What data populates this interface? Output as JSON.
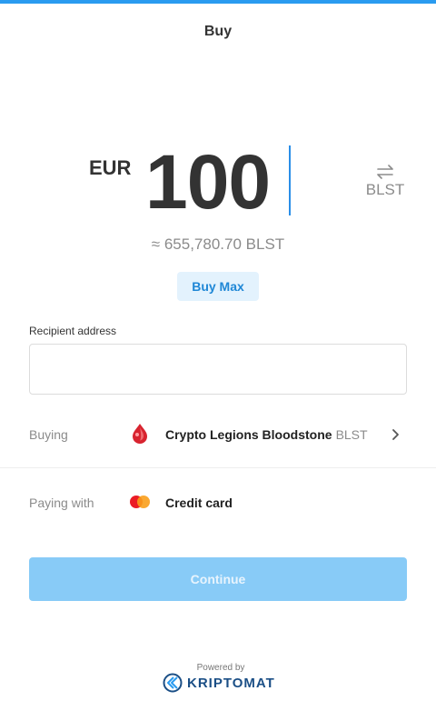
{
  "header": {
    "title": "Buy"
  },
  "amount": {
    "currency": "EUR",
    "value": "100",
    "swap_currency": "BLST",
    "swap_icon": "swap-arrows-icon",
    "approx": "≈ 655,780.70 BLST"
  },
  "buy_max_label": "Buy Max",
  "recipient": {
    "label": "Recipient address",
    "value": "",
    "placeholder": ""
  },
  "buying": {
    "label": "Buying",
    "name": "Crypto Legions Bloodstone",
    "ticker": "BLST",
    "icon": "bloodstone-token-icon"
  },
  "paying": {
    "label": "Paying with",
    "method": "Credit card",
    "icon": "mastercard-icon"
  },
  "continue_label": "Continue",
  "footer": {
    "powered_by": "Powered by",
    "brand": "KRIPTOMAT"
  },
  "colors": {
    "accent": "#2a9bf0",
    "continue_bg": "#88cbf7",
    "buy_max_bg": "#e3f2fd",
    "brand": "#1b4f86"
  }
}
